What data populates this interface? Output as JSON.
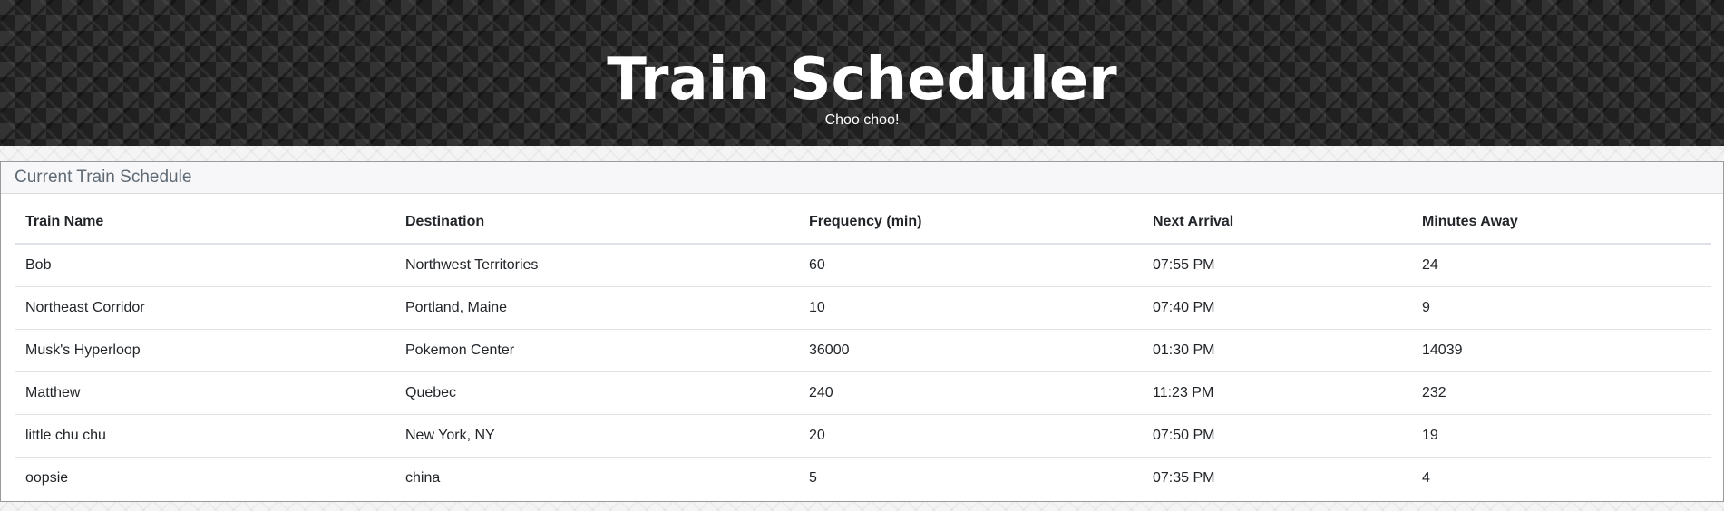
{
  "header": {
    "title": "Train Scheduler",
    "subtitle": "Choo choo!"
  },
  "schedule": {
    "title": "Current Train Schedule",
    "columns": [
      "Train Name",
      "Destination",
      "Frequency (min)",
      "Next Arrival",
      "Minutes Away"
    ],
    "rows": [
      [
        "Bob",
        "Northwest Territories",
        "60",
        "07:55 PM",
        "24"
      ],
      [
        "Northeast Corridor",
        "Portland, Maine",
        "10",
        "07:40 PM",
        "9"
      ],
      [
        "Musk's Hyperloop",
        "Pokemon Center",
        "36000",
        "01:30 PM",
        "14039"
      ],
      [
        "Matthew",
        "Quebec",
        "240",
        "11:23 PM",
        "232"
      ],
      [
        "little chu chu",
        "New York, NY",
        "20",
        "07:50 PM",
        "19"
      ],
      [
        "oopsie",
        "china",
        "5",
        "07:35 PM",
        "4"
      ]
    ]
  },
  "colors": {
    "header_background": "#2a2a2a",
    "header_text": "#ffffff",
    "card_title": "#5f6a75",
    "table_border": "#dee2e6"
  }
}
